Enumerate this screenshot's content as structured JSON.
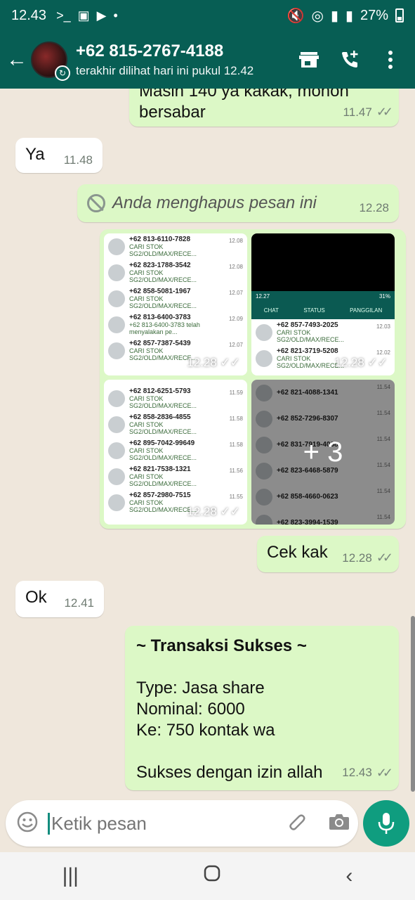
{
  "status_bar": {
    "time": "12.43",
    "battery": "27%"
  },
  "header": {
    "contact_name": "+62 815-2767-4188",
    "last_seen": "terakhir dilihat hari ini pukul 12.42"
  },
  "messages": [
    {
      "partial_text_line1": "Masih 140 ya kakak, mohon",
      "partial_text_line2": "bersabar",
      "time": "11.47"
    },
    {
      "text": "Ya",
      "time": "11.48"
    },
    {
      "text": "Anda menghapus pesan ini",
      "time": "12.28"
    },
    {
      "text": "Cek kak",
      "time": "12.28"
    },
    {
      "text": "Ok",
      "time": "12.41"
    },
    {
      "title": "~ Transaksi Sukses ~",
      "line1": "Type: Jasa share",
      "line2": "Nominal: 6000",
      "line3": "Ke: 750 kontak wa",
      "line4": "Sukses dengan izin allah",
      "time": "12.43"
    }
  ],
  "media": {
    "stamp_time": "12.28",
    "more_count": "+ 3",
    "image1": [
      {
        "num": "+62 813-6110-7828",
        "msg": "CARI STOK SG2/OLD/MAX/RECE...",
        "t": "12.08"
      },
      {
        "num": "+62 823-1788-3542",
        "msg": "CARI STOK SG2/OLD/MAX/RECE...",
        "t": "12.08"
      },
      {
        "num": "+62 858-5081-1967",
        "msg": "CARI STOK SG2/OLD/MAX/RECE...",
        "t": "12.07"
      },
      {
        "num": "+62 813-6400-3783",
        "msg": "+62 813-6400-3783 telah menyalakan pe...",
        "t": "12.09"
      },
      {
        "num": "+62 857-7387-5439",
        "msg": "CARI STOK SG2/OLD/MAX/RECE...",
        "t": "12.07"
      }
    ],
    "image2": {
      "mini_time": "12.27",
      "mini_battery": "31%",
      "tabs": [
        "CHAT",
        "STATUS",
        "PANGGILAN"
      ],
      "rows": [
        {
          "num": "+62 857-7493-2025",
          "msg": "CARI STOK SG2/OLD/MAX/RECE...",
          "t": "12.03"
        },
        {
          "num": "+62 821-3719-5208",
          "msg": "CARI STOK SG2/OLD/MAX/RECE...",
          "t": "12.02"
        }
      ]
    },
    "image3": [
      {
        "num": "+62 812-6251-5793",
        "msg": "CARI STOK SG2/OLD/MAX/RECE...",
        "t": "11.59"
      },
      {
        "num": "+62 858-2836-4855",
        "msg": "CARI STOK SG2/OLD/MAX/RECE...",
        "t": "11.58"
      },
      {
        "num": "+62 895-7042-99649",
        "msg": "CARI STOK SG2/OLD/MAX/RECE...",
        "t": "11.58"
      },
      {
        "num": "+62 821-7538-1321",
        "msg": "CARI STOK SG2/OLD/MAX/RECE...",
        "t": "11.56"
      },
      {
        "num": "+62 857-2980-7515",
        "msg": "CARI STOK SG2/OLD/MAX/RECE...",
        "t": "11.55"
      }
    ],
    "image4": [
      {
        "num": "+62 821-4088-1341",
        "t": "11.54"
      },
      {
        "num": "+62 852-7296-8307",
        "t": "11.54"
      },
      {
        "num": "+62 831-7919-4068",
        "t": "11.54"
      },
      {
        "num": "+62 823-6468-5879",
        "t": "11.54"
      },
      {
        "num": "+62 858-4660-0623",
        "t": "11.54"
      },
      {
        "num": "+62 823-3994-1539",
        "t": "11.54"
      }
    ]
  },
  "input": {
    "placeholder": "Ketik pesan"
  },
  "colors": {
    "header": "#075e54",
    "outgoing": "#dcf8c6",
    "incoming": "#ffffff",
    "accent": "#0f9d7f"
  }
}
